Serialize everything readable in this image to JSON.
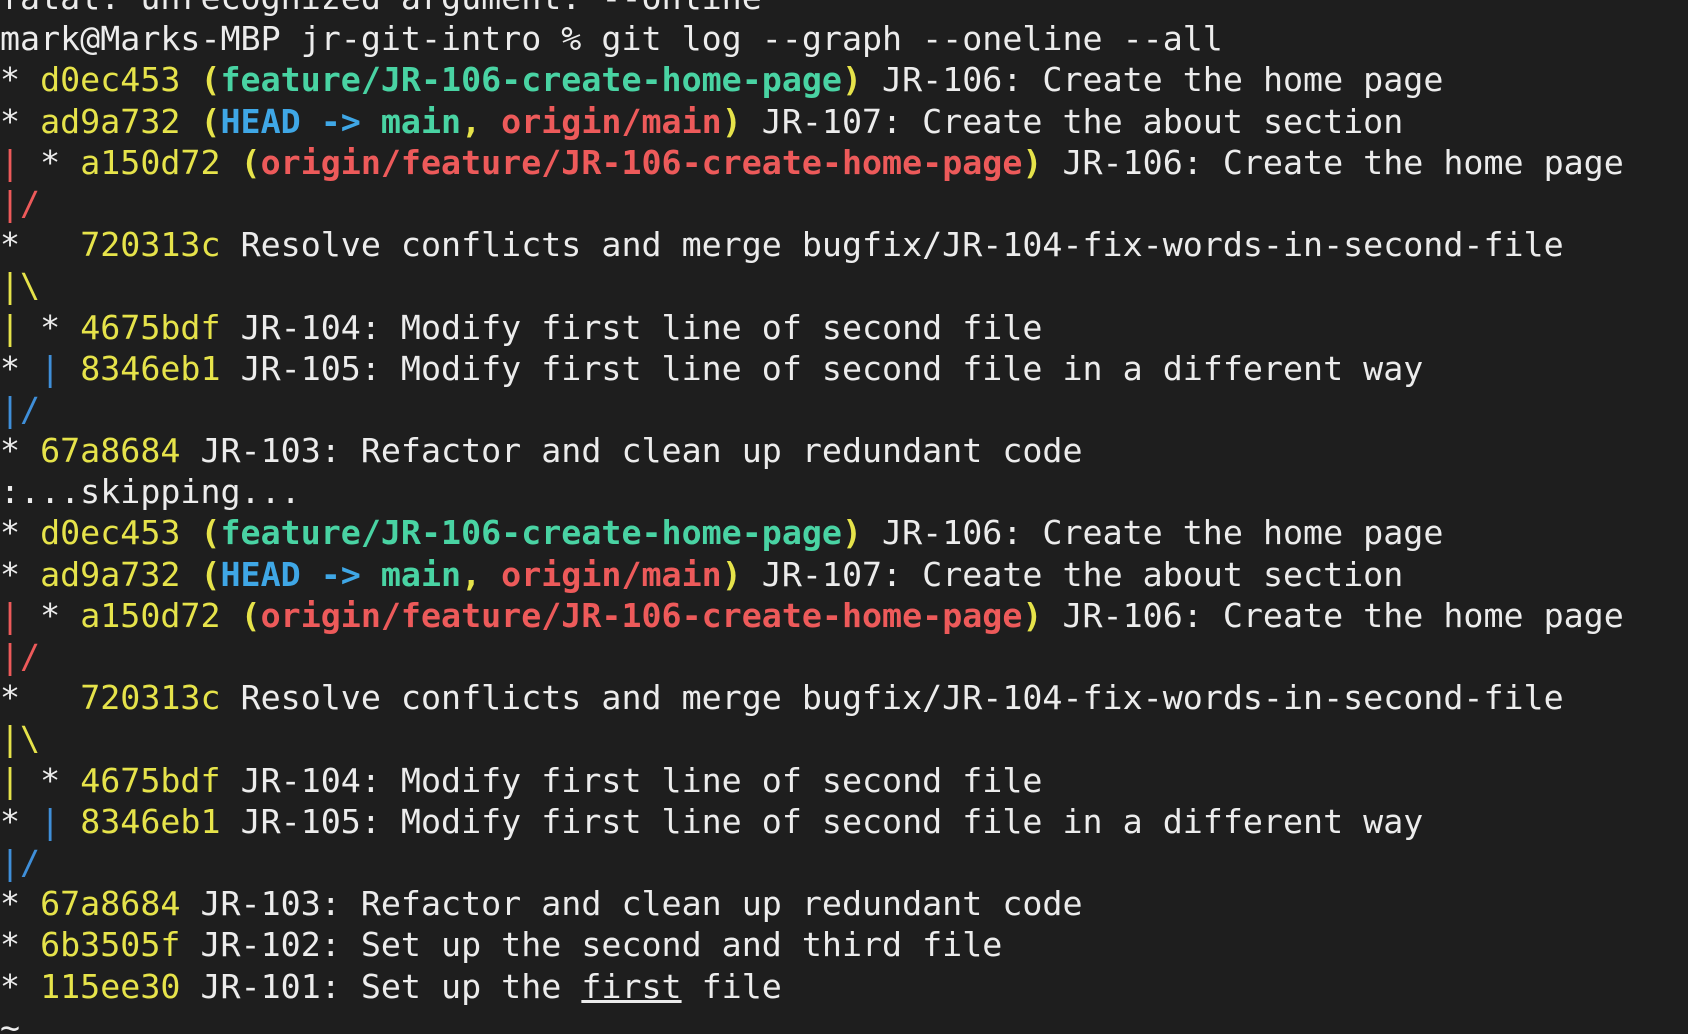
{
  "terminal": {
    "colors": {
      "background": "#1e1e1e",
      "foreground": "#ececec",
      "hash_yellow": "#e6e34a",
      "remote_red": "#ed5a5a",
      "local_green": "#49d3a3",
      "head_blue": "#3fa7e6",
      "graph_blue": "#3f8fd9"
    },
    "lines": [
      [
        {
          "t": "fatal: unrecognized argument: --online",
          "c": "d"
        }
      ],
      [
        {
          "t": "mark@Marks-MBP jr-git-intro % git log --graph --oneline --all",
          "c": "d"
        }
      ],
      [
        {
          "t": "* ",
          "c": "d"
        },
        {
          "t": "d0ec453 ",
          "c": "y"
        },
        {
          "t": "(",
          "c": "by"
        },
        {
          "t": "feature/JR-106-create-home-page",
          "c": "bg"
        },
        {
          "t": ")",
          "c": "by"
        },
        {
          "t": " JR-106: Create the home page",
          "c": "d"
        }
      ],
      [
        {
          "t": "* ",
          "c": "d"
        },
        {
          "t": "ad9a732 ",
          "c": "y"
        },
        {
          "t": "(",
          "c": "by"
        },
        {
          "t": "HEAD -> ",
          "c": "bb"
        },
        {
          "t": "main",
          "c": "bg"
        },
        {
          "t": ", ",
          "c": "by"
        },
        {
          "t": "origin/main",
          "c": "br"
        },
        {
          "t": ")",
          "c": "by"
        },
        {
          "t": " JR-107: Create the about section",
          "c": "d"
        }
      ],
      [
        {
          "t": "|",
          "c": "r"
        },
        {
          "t": " * ",
          "c": "d"
        },
        {
          "t": "a150d72 ",
          "c": "y"
        },
        {
          "t": "(",
          "c": "by"
        },
        {
          "t": "origin/feature/JR-106-create-home-page",
          "c": "br"
        },
        {
          "t": ")",
          "c": "by"
        },
        {
          "t": " JR-106: Create the home page",
          "c": "d"
        }
      ],
      [
        {
          "t": "|/",
          "c": "r"
        }
      ],
      [
        {
          "t": "*   ",
          "c": "d"
        },
        {
          "t": "720313c ",
          "c": "y"
        },
        {
          "t": "Resolve conflicts and merge bugfix/JR-104-fix-words-in-second-file",
          "c": "d"
        }
      ],
      [
        {
          "t": "|\\",
          "c": "y"
        }
      ],
      [
        {
          "t": "|",
          "c": "y"
        },
        {
          "t": " * ",
          "c": "d"
        },
        {
          "t": "4675bdf ",
          "c": "y"
        },
        {
          "t": "JR-104: Modify first line of second file",
          "c": "d"
        }
      ],
      [
        {
          "t": "* ",
          "c": "d"
        },
        {
          "t": "|",
          "c": "b"
        },
        {
          "t": " ",
          "c": "d"
        },
        {
          "t": "8346eb1 ",
          "c": "y"
        },
        {
          "t": "JR-105: Modify first line of second file in a different way",
          "c": "d"
        }
      ],
      [
        {
          "t": "|/",
          "c": "b"
        }
      ],
      [
        {
          "t": "* ",
          "c": "d"
        },
        {
          "t": "67a8684 ",
          "c": "y"
        },
        {
          "t": "JR-103: Refactor and clean up redundant code",
          "c": "d"
        }
      ],
      [
        {
          "t": ":...skipping...",
          "c": "d"
        }
      ],
      [
        {
          "t": "* ",
          "c": "d"
        },
        {
          "t": "d0ec453 ",
          "c": "y"
        },
        {
          "t": "(",
          "c": "by"
        },
        {
          "t": "feature/JR-106-create-home-page",
          "c": "bg"
        },
        {
          "t": ")",
          "c": "by"
        },
        {
          "t": " JR-106: Create the home page",
          "c": "d"
        }
      ],
      [
        {
          "t": "* ",
          "c": "d"
        },
        {
          "t": "ad9a732 ",
          "c": "y"
        },
        {
          "t": "(",
          "c": "by"
        },
        {
          "t": "HEAD -> ",
          "c": "bb"
        },
        {
          "t": "main",
          "c": "bg"
        },
        {
          "t": ", ",
          "c": "by"
        },
        {
          "t": "origin/main",
          "c": "br"
        },
        {
          "t": ")",
          "c": "by"
        },
        {
          "t": " JR-107: Create the about section",
          "c": "d"
        }
      ],
      [
        {
          "t": "|",
          "c": "r"
        },
        {
          "t": " * ",
          "c": "d"
        },
        {
          "t": "a150d72 ",
          "c": "y"
        },
        {
          "t": "(",
          "c": "by"
        },
        {
          "t": "origin/feature/JR-106-create-home-page",
          "c": "br"
        },
        {
          "t": ")",
          "c": "by"
        },
        {
          "t": " JR-106: Create the home page",
          "c": "d"
        }
      ],
      [
        {
          "t": "|/",
          "c": "r"
        }
      ],
      [
        {
          "t": "*   ",
          "c": "d"
        },
        {
          "t": "720313c ",
          "c": "y"
        },
        {
          "t": "Resolve conflicts and merge bugfix/JR-104-fix-words-in-second-file",
          "c": "d"
        }
      ],
      [
        {
          "t": "|\\",
          "c": "y"
        }
      ],
      [
        {
          "t": "|",
          "c": "y"
        },
        {
          "t": " * ",
          "c": "d"
        },
        {
          "t": "4675bdf ",
          "c": "y"
        },
        {
          "t": "JR-104: Modify first line of second file",
          "c": "d"
        }
      ],
      [
        {
          "t": "* ",
          "c": "d"
        },
        {
          "t": "|",
          "c": "b"
        },
        {
          "t": " ",
          "c": "d"
        },
        {
          "t": "8346eb1 ",
          "c": "y"
        },
        {
          "t": "JR-105: Modify first line of second file in a different way",
          "c": "d"
        }
      ],
      [
        {
          "t": "|/",
          "c": "b"
        }
      ],
      [
        {
          "t": "* ",
          "c": "d"
        },
        {
          "t": "67a8684 ",
          "c": "y"
        },
        {
          "t": "JR-103: Refactor and clean up redundant code",
          "c": "d"
        }
      ],
      [
        {
          "t": "* ",
          "c": "d"
        },
        {
          "t": "6b3505f ",
          "c": "y"
        },
        {
          "t": "JR-102: Set up the second and third file",
          "c": "d"
        }
      ],
      [
        {
          "t": "* ",
          "c": "d"
        },
        {
          "t": "115ee30 ",
          "c": "y"
        },
        {
          "t": "JR-101: Set up the ",
          "c": "d"
        },
        {
          "t": "first",
          "c": "u"
        },
        {
          "t": " file",
          "c": "d"
        }
      ],
      [
        {
          "t": "~",
          "c": "d"
        }
      ]
    ]
  }
}
